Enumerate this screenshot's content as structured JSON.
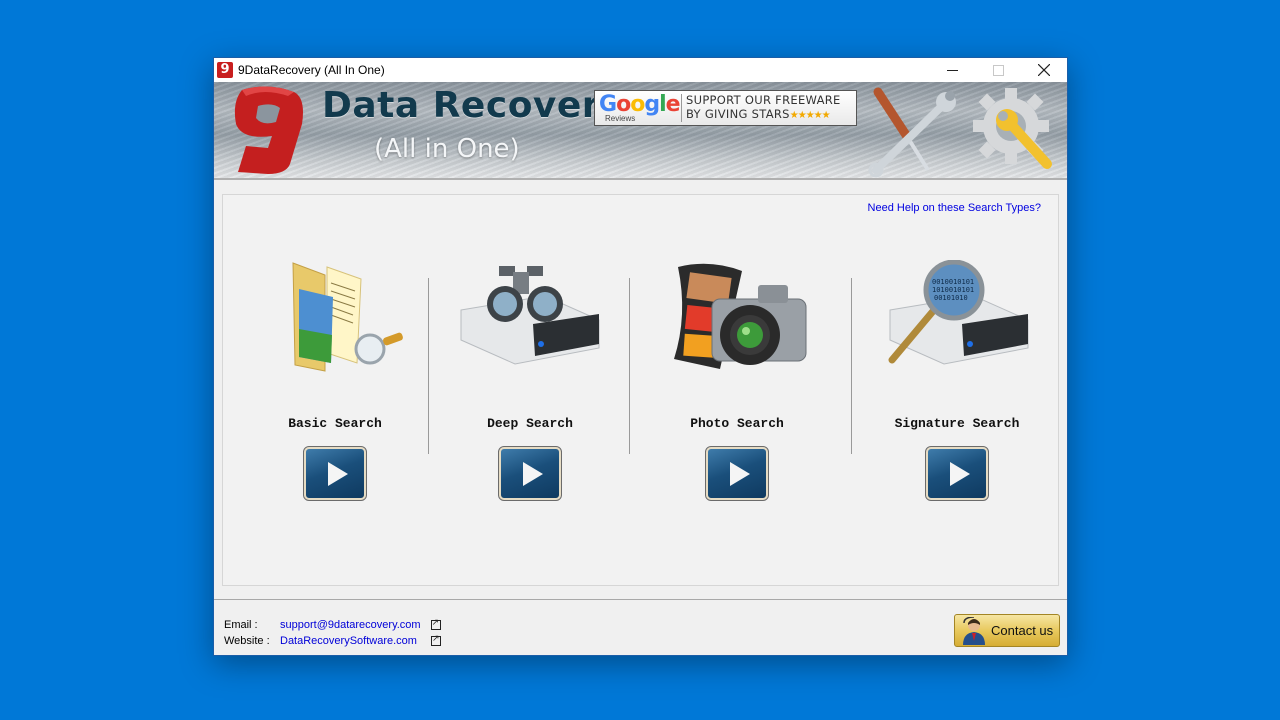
{
  "window": {
    "title": "9DataRecovery (All In One)",
    "controls": {
      "minimize": "minimize",
      "maximize": "maximize",
      "close": "close"
    }
  },
  "banner": {
    "logo_glyph": "9",
    "title": "Data Recovery",
    "subtitle": "(All in One)",
    "google_badge": {
      "logo_text": "Google",
      "reviews_label": "Reviews",
      "line1": "SUPPORT OUR FREEWARE",
      "line2": "BY GIVING STARS",
      "stars": "★★★★★"
    }
  },
  "main": {
    "help_link": "Need Help on these Search Types?",
    "search_types": [
      {
        "label": "Basic Search",
        "icon": "folder-search-icon"
      },
      {
        "label": "Deep Search",
        "icon": "drive-binoculars-icon"
      },
      {
        "label": "Photo Search",
        "icon": "camera-film-icon"
      },
      {
        "label": "Signature Search",
        "icon": "drive-magnifier-icon"
      }
    ]
  },
  "footer": {
    "email_label": "Email :",
    "email_value": "support@9datarecovery.com",
    "website_label": "Website :",
    "website_value": "DataRecoverySoftware.com",
    "contact_button": "Contact us"
  },
  "colors": {
    "desktop": "#0078d7",
    "link": "#0000e0",
    "logo_red": "#c81e1e",
    "brand_title": "#123a4d"
  }
}
